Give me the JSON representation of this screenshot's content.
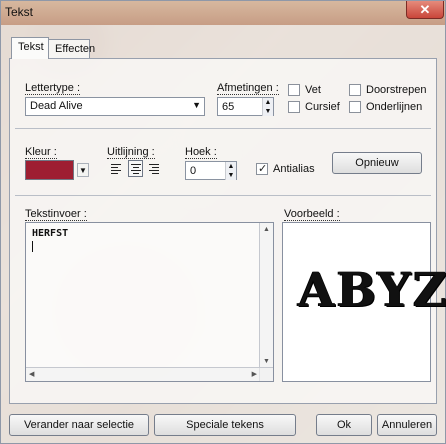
{
  "window": {
    "title": "Tekst",
    "close_glyph": "✕"
  },
  "tabs": [
    "Tekst",
    "Effecten"
  ],
  "fields": {
    "font_label": "Lettertype :",
    "font_value": "Dead Alive",
    "size_label": "Afmetingen :",
    "size_value": "65",
    "bold_label": "Vet",
    "italic_label": "Cursief",
    "strikethrough_label": "Doorstrepen",
    "underline_label": "Onderlijnen",
    "color_label": "Kleur :",
    "align_label": "Uitlijning :",
    "angle_label": "Hoek :",
    "angle_value": "0",
    "antialias_label": "Antialias",
    "reset_button": "Opnieuw",
    "text_input_label": "Tekstinvoer :",
    "preview_label": "Voorbeeld :",
    "text_value": "HERFST",
    "preview_value": "ABYZ"
  },
  "states": {
    "antialias": true,
    "bold": false,
    "italic": false,
    "strikethrough": false,
    "underline": false
  },
  "colors": {
    "text_color": "#9e1e32",
    "alignment_selected": "center"
  },
  "footer": {
    "convert_selection": "Verander naar selectie",
    "special_chars": "Speciale tekens",
    "ok": "Ok",
    "cancel": "Annuleren"
  }
}
